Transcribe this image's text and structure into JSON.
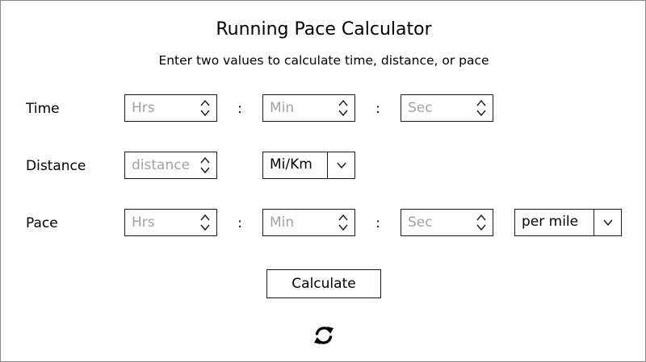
{
  "header": {
    "title": "Running Pace Calculator",
    "subtitle": "Enter two values to calculate time, distance, or pace"
  },
  "time": {
    "label": "Time",
    "hours_placeholder": "Hrs",
    "minutes_placeholder": "Min",
    "seconds_placeholder": "Sec",
    "separator": ":"
  },
  "distance": {
    "label": "Distance",
    "placeholder": "distance",
    "unit_selected": "Mi/Km"
  },
  "pace": {
    "label": "Pace",
    "hours_placeholder": "Hrs",
    "minutes_placeholder": "Min",
    "seconds_placeholder": "Sec",
    "separator": ":",
    "unit_selected": "per mile"
  },
  "actions": {
    "calculate_label": "Calculate",
    "reset_icon": "refresh-icon"
  },
  "colors": {
    "border": "#1a1a1a",
    "placeholder": "#a3a3a3",
    "background": "#ffffff"
  }
}
